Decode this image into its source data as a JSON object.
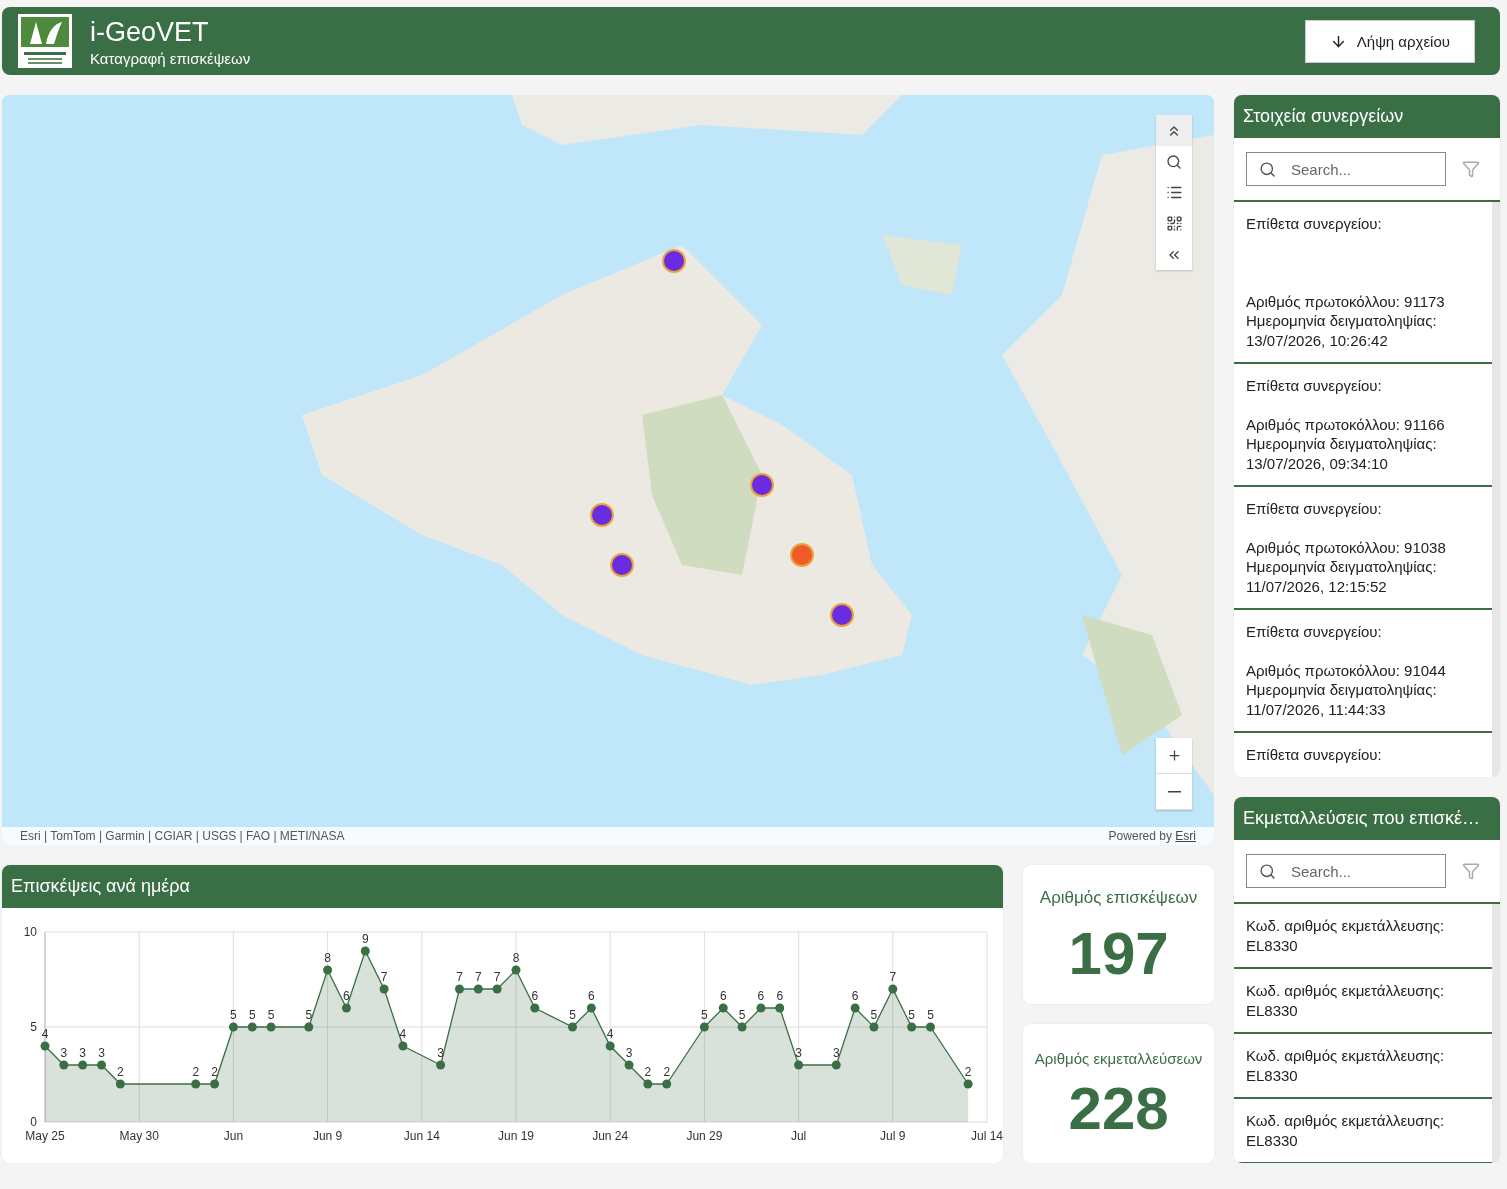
{
  "header": {
    "title": "i-GeoVET",
    "subtitle": "Καταγραφή επισκέψεων",
    "download_button": "Λήψη αρχείου"
  },
  "map": {
    "kind": "picture",
    "attribution": "Esri | TomTom | Garmin | CGIAR | USGS | FAO | METI/NASA",
    "powered_by": "Powered by",
    "powered_by_link": "Esri"
  },
  "visits_chart": {
    "title": "Επισκέψεις ανά ημέρα",
    "chart_data": {
      "type": "area",
      "categories": [
        "May 25",
        null,
        null,
        null,
        null,
        "May 30",
        null,
        null,
        null,
        null,
        "Jun",
        null,
        null,
        null,
        null,
        "Jun 9",
        null,
        null,
        null,
        null,
        "Jun 14",
        null,
        null,
        null,
        null,
        "Jun 19",
        null,
        null,
        null,
        null,
        "Jun 24",
        null,
        null,
        null,
        null,
        "Jun 29",
        null,
        null,
        null,
        null,
        "Jul",
        null,
        null,
        null,
        null,
        "Jul 9",
        null,
        null,
        null,
        null,
        "Jul 14"
      ],
      "series": [
        {
          "color": "#3a6e45",
          "values": [
            4,
            3,
            3,
            3,
            2,
            null,
            null,
            null,
            2,
            2,
            5,
            5,
            5,
            null,
            5,
            8,
            6,
            9,
            7,
            4,
            null,
            3,
            7,
            7,
            7,
            8,
            6,
            null,
            5,
            6,
            4,
            3,
            2,
            2,
            null,
            5,
            6,
            5,
            6,
            6,
            3,
            null,
            3,
            6,
            5,
            7,
            5,
            5,
            null,
            2,
            null
          ]
        }
      ],
      "ylim": [
        0,
        10
      ],
      "yticks": [
        0,
        5,
        10
      ],
      "grid": true,
      "data_labels": true
    }
  },
  "kpis": [
    {
      "label": "Αριθμός επισκέψεων",
      "value": "197"
    },
    {
      "label": "Αριθμός εκμεταλλεύσεων",
      "value": "228"
    }
  ],
  "workshops_panel": {
    "title": "Στοιχεία συνεργείων",
    "search": {
      "placeholder": "Search..."
    },
    "items": [
      {
        "surname_label": "Επίθετα συνεργείου:",
        "protocol": "Αριθμός πρωτοκόλλου: 91173",
        "date_label": "Ημερομηνία δειγματοληψίας:",
        "date": "13/07/2026, 10:26:42"
      },
      {
        "surname_label": "Επίθετα συνεργείου:",
        "protocol": "Αριθμός πρωτοκόλλου: 91166",
        "date_label": "Ημερομηνία δειγματοληψίας:",
        "date": "13/07/2026, 09:34:10"
      },
      {
        "surname_label": "Επίθετα συνεργείου:",
        "protocol": "Αριθμός πρωτοκόλλου: 91038",
        "date_label": "Ημερομηνία δειγματοληψίας:",
        "date": "11/07/2026, 12:15:52"
      },
      {
        "surname_label": "Επίθετα συνεργείου:",
        "protocol": "Αριθμός πρωτοκόλλου: 91044",
        "date_label": "Ημερομηνία δειγματοληψίας:",
        "date": "11/07/2026, 11:44:33"
      },
      {
        "surname_label": "Επίθετα συνεργείου:"
      }
    ]
  },
  "farms_panel": {
    "title": "Εκμεταλλεύσεις που επισκέ…",
    "search": {
      "placeholder": "Search..."
    },
    "items": [
      {
        "label": "Κωδ. αριθμός εκμετάλλευσης:",
        "code": "EL8330"
      },
      {
        "label": "Κωδ. αριθμός εκμετάλλευσης:",
        "code": "EL8330"
      },
      {
        "label": "Κωδ. αριθμός εκμετάλλευσης:",
        "code": "EL8330"
      },
      {
        "label": "Κωδ. αριθμός εκμετάλλευσης:",
        "code": "EL8330"
      }
    ]
  }
}
